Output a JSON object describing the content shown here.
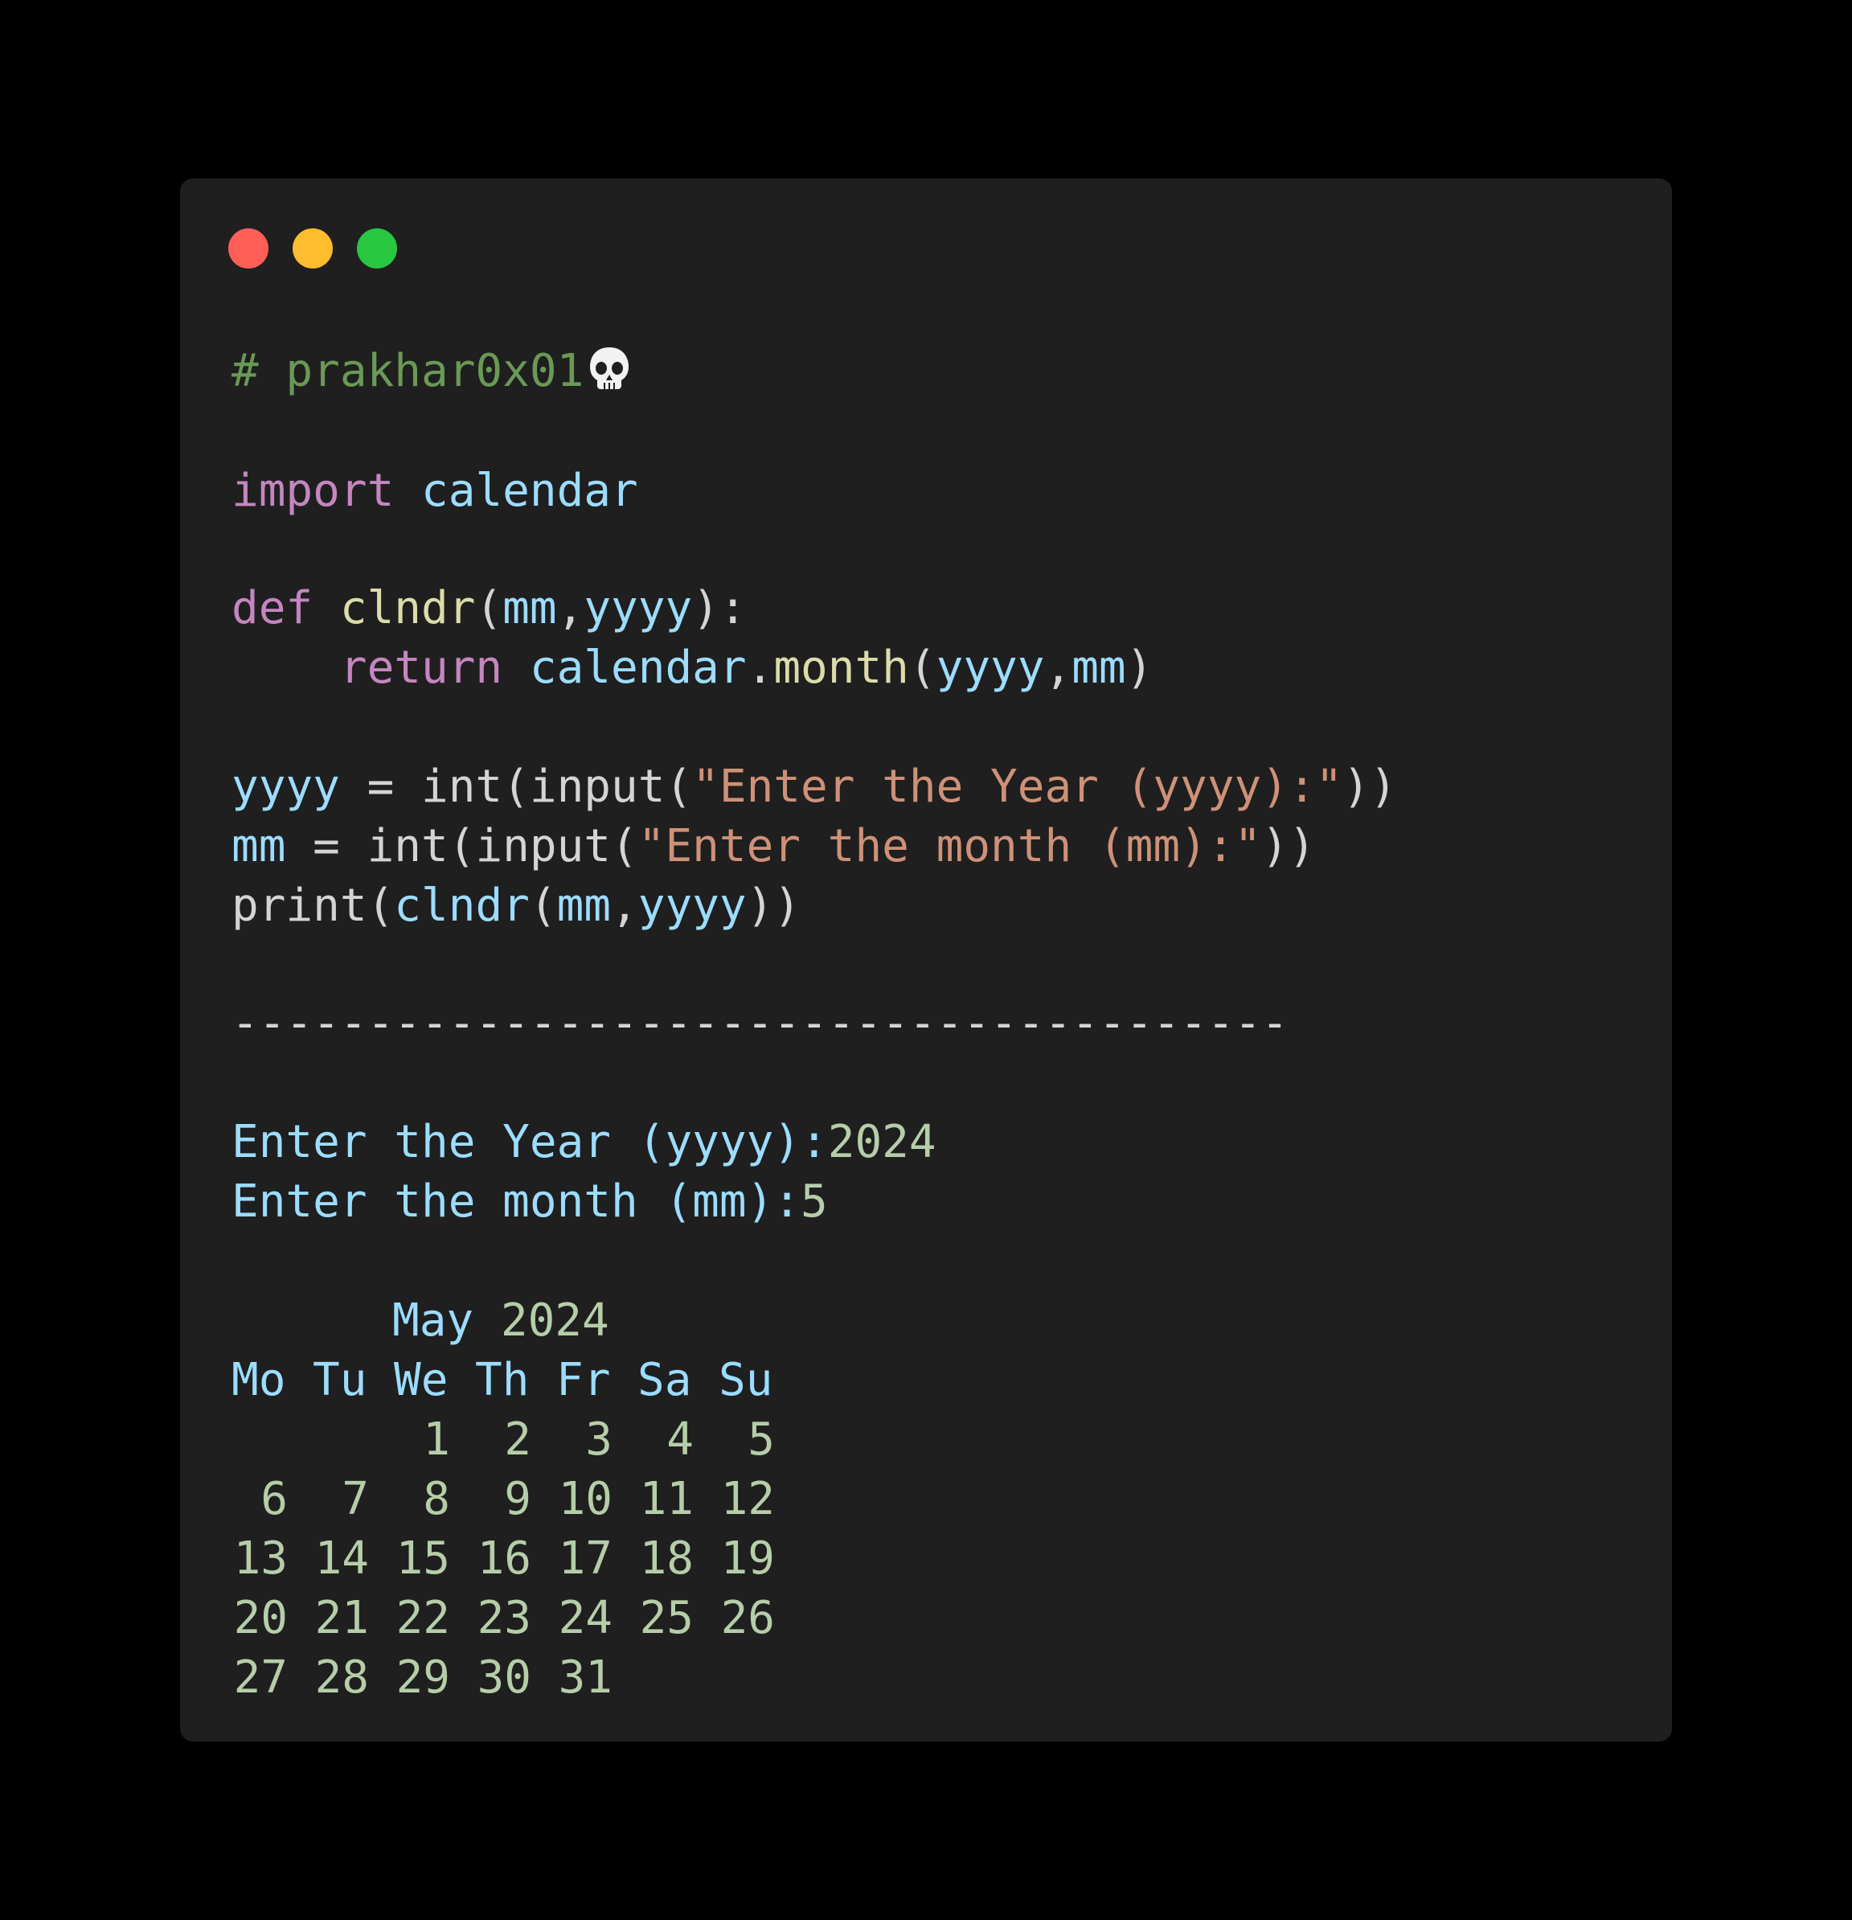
{
  "window": {
    "controls": {
      "close_color": "#ff5f57",
      "minimize_color": "#febc2e",
      "zoom_color": "#28c840"
    }
  },
  "code": {
    "comment": "# prakhar0x01",
    "comment_icon": "skull-icon",
    "import_kw": "import",
    "import_module": "calendar",
    "def_kw": "def",
    "def_name": "clndr",
    "def_open": "(",
    "def_p1": "mm",
    "def_comma": ",",
    "def_p2": "yyyy",
    "def_close": "):",
    "ret_indent": "    ",
    "ret_kw": "return",
    "ret_obj": "calendar",
    "ret_dot": ".",
    "ret_fn": "month",
    "ret_open": "(",
    "ret_a1": "yyyy",
    "ret_comma": ",",
    "ret_a2": "mm",
    "ret_close": ")",
    "l1_var": "yyyy",
    "l1_eq": " = int(input(",
    "l1_str": "\"Enter the Year (yyyy):\"",
    "l1_close": "))",
    "l2_var": "mm",
    "l2_eq": " = int(input(",
    "l2_str": "\"Enter the month (mm):\"",
    "l2_close": "))",
    "l3_print": "print(",
    "l3_fn": "clndr",
    "l3_open": "(",
    "l3_a1": "mm",
    "l3_comma": ",",
    "l3_a2": "yyyy",
    "l3_close": "))"
  },
  "separator": "---------------------------------------",
  "output": {
    "prompt_year": "Enter the Year (yyyy):",
    "value_year": "2024",
    "prompt_month": "Enter the month (mm):",
    "value_month": "5"
  },
  "calendar": {
    "title_month": "May",
    "title_year": "2024",
    "weekdays": [
      "Mo",
      "Tu",
      "We",
      "Th",
      "Fr",
      "Sa",
      "Su"
    ],
    "weeks": [
      [
        "",
        "",
        "1",
        "2",
        "3",
        "4",
        "5"
      ],
      [
        "6",
        "7",
        "8",
        "9",
        "10",
        "11",
        "12"
      ],
      [
        "13",
        "14",
        "15",
        "16",
        "17",
        "18",
        "19"
      ],
      [
        "20",
        "21",
        "22",
        "23",
        "24",
        "25",
        "26"
      ],
      [
        "27",
        "28",
        "29",
        "30",
        "31",
        "",
        ""
      ]
    ]
  }
}
